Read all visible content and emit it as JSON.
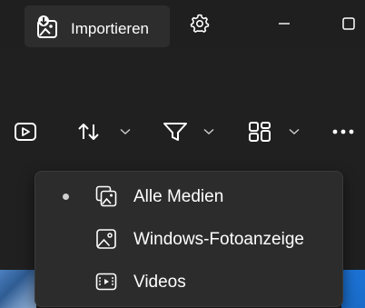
{
  "titlebar": {
    "import_label": "Importieren",
    "import_icon": "import-photo-icon",
    "settings_icon": "gear-icon",
    "minimize_icon": "minimize-icon",
    "maximize_icon": "maximize-icon"
  },
  "toolbar": {
    "items": [
      {
        "icon": "slideshow-icon"
      },
      {
        "icon": "sort-icon",
        "dropdown": true
      },
      {
        "icon": "filter-icon",
        "dropdown": true
      },
      {
        "icon": "layout-icon",
        "dropdown": true
      },
      {
        "icon": "more-icon"
      }
    ]
  },
  "menu": {
    "items": [
      {
        "label": "Alle Medien",
        "icon": "all-media-icon",
        "selected": true
      },
      {
        "label": "Windows-Fotoanzeige",
        "icon": "image-icon",
        "selected": false
      },
      {
        "label": "Videos",
        "icon": "video-icon",
        "selected": false
      }
    ]
  },
  "colors": {
    "background": "#202020",
    "titlebar": "#1f1f1f",
    "menu_background": "#2c2c2c",
    "text": "#ffffff"
  }
}
